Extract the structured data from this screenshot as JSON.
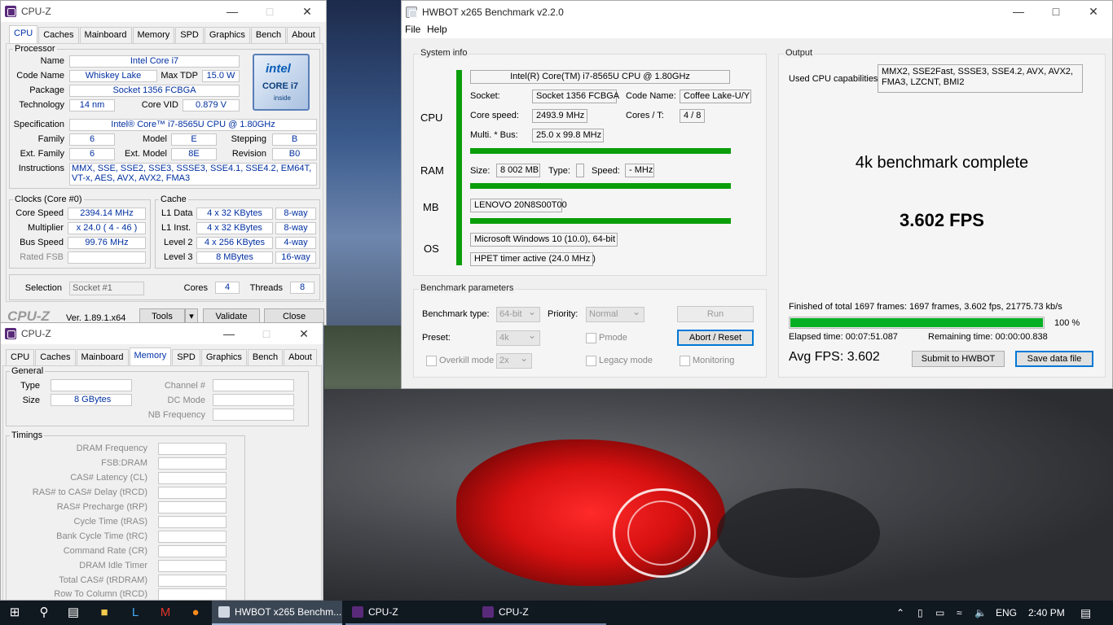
{
  "cpuz1": {
    "title": "CPU-Z",
    "tabs": [
      "CPU",
      "Caches",
      "Mainboard",
      "Memory",
      "SPD",
      "Graphics",
      "Bench",
      "About"
    ],
    "processor": {
      "group": "Processor",
      "name_label": "Name",
      "name": "Intel Core i7",
      "codename_label": "Code Name",
      "codename": "Whiskey Lake",
      "maxtdp_label": "Max TDP",
      "maxtdp": "15.0 W",
      "package_label": "Package",
      "package": "Socket 1356 FCBGA",
      "technology_label": "Technology",
      "technology": "14 nm",
      "corevid_label": "Core VID",
      "corevid": "0.879 V",
      "spec_label": "Specification",
      "spec": "Intel® Core™ i7-8565U CPU @ 1.80GHz",
      "family_label": "Family",
      "family": "6",
      "model_label": "Model",
      "model": "E",
      "stepping_label": "Stepping",
      "stepping": "B",
      "extfamily_label": "Ext. Family",
      "extfamily": "6",
      "extmodel_label": "Ext. Model",
      "extmodel": "8E",
      "revision_label": "Revision",
      "revision": "B0",
      "instr_label": "Instructions",
      "instr": "MMX, SSE, SSE2, SSE3, SSSE3, SSE4.1, SSE4.2, EM64T, VT-x, AES, AVX, AVX2, FMA3",
      "logo_intel": "intel",
      "logo_core": "CORE i7",
      "logo_inside": "inside"
    },
    "clocks": {
      "group": "Clocks (Core #0)",
      "corespeed_label": "Core Speed",
      "corespeed": "2394.14 MHz",
      "multiplier_label": "Multiplier",
      "multiplier": "x 24.0 ( 4 - 46 )",
      "busspeed_label": "Bus Speed",
      "busspeed": "99.76 MHz",
      "ratedfsb_label": "Rated FSB",
      "ratedfsb": ""
    },
    "cache": {
      "group": "Cache",
      "l1data_label": "L1 Data",
      "l1data": "4 x 32 KBytes",
      "l1data_way": "8-way",
      "l1inst_label": "L1 Inst.",
      "l1inst": "4 x 32 KBytes",
      "l1inst_way": "8-way",
      "l2_label": "Level 2",
      "l2": "4 x 256 KBytes",
      "l2_way": "4-way",
      "l3_label": "Level 3",
      "l3": "8 MBytes",
      "l3_way": "16-way"
    },
    "selection_label": "Selection",
    "selection": "Socket #1",
    "cores_label": "Cores",
    "cores": "4",
    "threads_label": "Threads",
    "threads": "8",
    "footer_logo": "CPU-Z",
    "version": "Ver. 1.89.1.x64",
    "tools_btn": "Tools",
    "validate_btn": "Validate",
    "close_btn": "Close"
  },
  "cpuz2": {
    "title": "CPU-Z",
    "tabs": [
      "CPU",
      "Caches",
      "Mainboard",
      "Memory",
      "SPD",
      "Graphics",
      "Bench",
      "About"
    ],
    "general": {
      "group": "General",
      "type_label": "Type",
      "type": "",
      "size_label": "Size",
      "size": "8 GBytes",
      "channel_label": "Channel #",
      "dcmode_label": "DC Mode",
      "nbfreq_label": "NB Frequency"
    },
    "timings": {
      "group": "Timings",
      "rows": [
        "DRAM Frequency",
        "FSB:DRAM",
        "CAS# Latency (CL)",
        "RAS# to CAS# Delay (tRCD)",
        "RAS# Precharge (tRP)",
        "Cycle Time (tRAS)",
        "Bank Cycle Time (tRC)",
        "Command Rate (CR)",
        "DRAM Idle Timer",
        "Total CAS# (tRDRAM)",
        "Row To Column (tRCD)"
      ]
    }
  },
  "hwbot": {
    "title": "HWBOT x265 Benchmark v2.2.0",
    "menu": [
      "File",
      "Help"
    ],
    "sysinfo": {
      "group": "System info",
      "cpu_label": "CPU",
      "ram_label": "RAM",
      "mb_label": "MB",
      "os_label": "OS",
      "cpu_name": "Intel(R) Core(TM) i7-8565U CPU @ 1.80GHz",
      "socket_label": "Socket:",
      "socket": "Socket 1356 FCBGA",
      "codename_label": "Code Name:",
      "codename": "Coffee Lake-U/Y",
      "corespeed_label": "Core speed:",
      "corespeed": "2493.9 MHz",
      "cores_label": "Cores / T:",
      "cores": "4 / 8",
      "multi_label": "Multi. * Bus:",
      "multi": "25.0 x 99.8 MHz",
      "size_label": "Size:",
      "size": "8 002 MB",
      "type_label": "Type:",
      "type": "",
      "speed_label": "Speed:",
      "speed": "- MHz",
      "mb": "LENOVO 20N8S00T00",
      "os": "Microsoft Windows 10 (10.0), 64-bit",
      "timer": "HPET timer active (24.0 MHz )"
    },
    "params": {
      "group": "Benchmark parameters",
      "benchtype_label": "Benchmark type:",
      "benchtype": "64-bit",
      "priority_label": "Priority:",
      "priority": "Normal",
      "run_btn": "Run",
      "preset_label": "Preset:",
      "preset": "4k",
      "pmode_label": "Pmode",
      "abort_btn": "Abort / Reset",
      "overkill_label": "Overkill mode",
      "overkill": "2x",
      "legacy_label": "Legacy mode",
      "monitoring_label": "Monitoring"
    },
    "output": {
      "group": "Output",
      "caps_label": "Used CPU capabilities:",
      "caps": "MMX2, SSE2Fast, SSSE3, SSE4.2, AVX, AVX2, FMA3, LZCNT, BMI2",
      "status": "4k benchmark complete",
      "fps": "3.602 FPS",
      "finished": "Finished of total 1697 frames: 1697 frames, 3.602 fps,  21775.73 kb/s",
      "progress_value": 100,
      "progress_text": "100 %",
      "elapsed": "Elapsed time: 00:07:51.087",
      "remaining": "Remaining time: 00:00:00.838",
      "avg": "Avg FPS: 3.602",
      "submit_btn": "Submit to HWBOT",
      "save_btn": "Save data file"
    }
  },
  "taskbar": {
    "tasks": [
      "HWBOT x265 Benchm...",
      "CPU-Z",
      "CPU-Z"
    ],
    "lang": "ENG",
    "time": "2:40 PM"
  }
}
